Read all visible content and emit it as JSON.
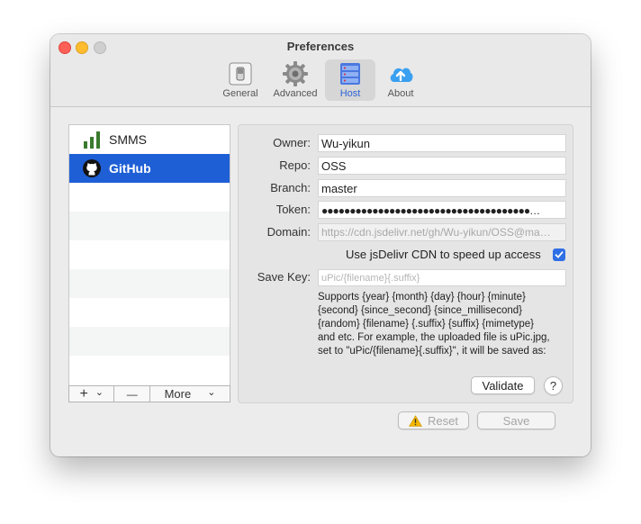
{
  "window": {
    "title": "Preferences"
  },
  "tabs": [
    {
      "label": "General",
      "icon": "switch-icon",
      "selected": false
    },
    {
      "label": "Advanced",
      "icon": "gear-icon",
      "selected": false
    },
    {
      "label": "Host",
      "icon": "host-icon",
      "selected": true
    },
    {
      "label": "About",
      "icon": "cloud-upload-icon",
      "selected": false
    }
  ],
  "hosts": [
    {
      "label": "SMMS",
      "icon": "bar-chart-icon",
      "selected": false
    },
    {
      "label": "GitHub",
      "icon": "github-icon",
      "selected": true
    }
  ],
  "list_bar": {
    "add": "+",
    "add_menu": "⌄",
    "remove": "—",
    "more": "More",
    "more_menu": "⌄"
  },
  "form": {
    "owner_label": "Owner:",
    "owner_value": "Wu-yikun",
    "repo_label": "Repo:",
    "repo_value": "OSS",
    "branch_label": "Branch:",
    "branch_value": "master",
    "token_label": "Token:",
    "token_value": "●●●●●●●●●●●●●●●●●●●●●●●●●●●●●●●●●●●●●…",
    "domain_label": "Domain:",
    "domain_value": "https://cdn.jsdelivr.net/gh/Wu-yikun/OSS@ma…",
    "cdn_label": "Use jsDelivr CDN to speed up access",
    "cdn_checked": true,
    "save_key_label": "Save Key:",
    "save_key_placeholder": "uPic/{filename}{.suffix}",
    "help_lines": [
      "Supports {year} {month} {day} {hour} {minute}",
      "{second} {since_second} {since_millisecond}",
      "{random} {filename} {.suffix} {suffix} {mimetype}",
      "and etc. For example, the uploaded file is uPic.jpg,",
      "set to \"uPic/{filename}{.suffix}\", it will be saved as:"
    ],
    "validate_label": "Validate",
    "help_label": "?"
  },
  "footer": {
    "reset_label": "Reset",
    "save_label": "Save"
  },
  "colors": {
    "accent": "#1e5fd6",
    "warning": "#f5b800"
  }
}
